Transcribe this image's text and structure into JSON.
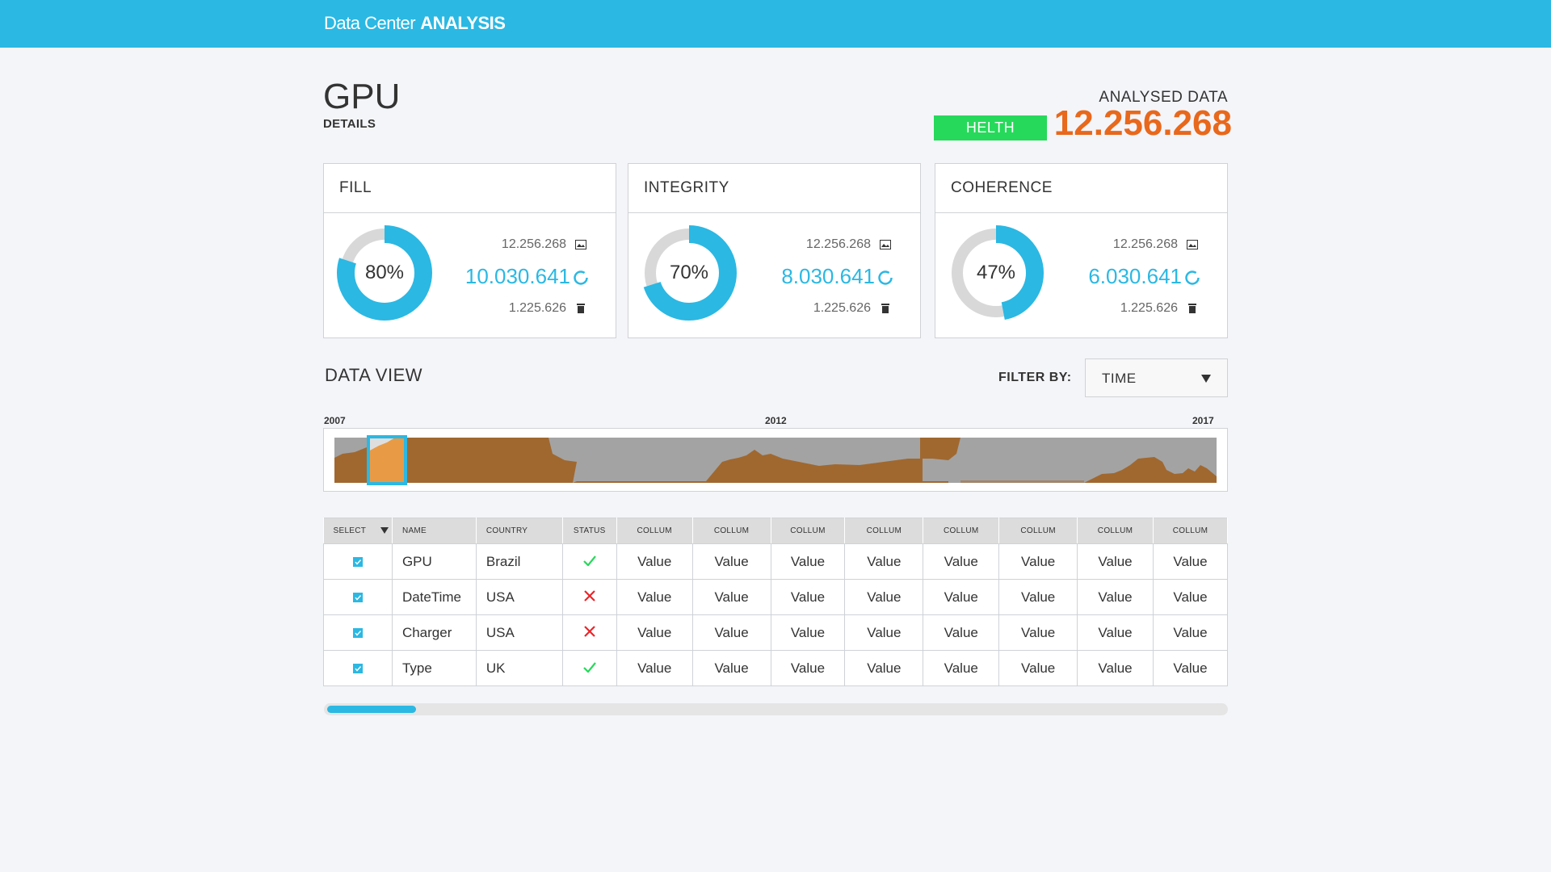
{
  "header": {
    "brand_light": "Data Center",
    "brand_bold": "ANALYSIS"
  },
  "page": {
    "title": "GPU",
    "subtitle": "DETAILS"
  },
  "summary": {
    "label": "ANALYSED DATA",
    "badge": "HELTH",
    "value": "12.256.268",
    "value_color": "#e8681c",
    "badge_color": "#26d95a"
  },
  "cards": [
    {
      "title": "FILL",
      "percent_label": "80%",
      "percent": 0.8,
      "total": "12.256.268",
      "analysed": "10.030.641",
      "deleted": "1.225.626"
    },
    {
      "title": "INTEGRITY",
      "percent_label": "70%",
      "percent": 0.7,
      "total": "12.256.268",
      "analysed": "8.030.641",
      "deleted": "1.225.626"
    },
    {
      "title": "COHERENCE",
      "percent_label": "47%",
      "percent": 0.47,
      "total": "12.256.268",
      "analysed": "6.030.641",
      "deleted": "1.225.626"
    }
  ],
  "data_view": {
    "title": "DATA VIEW",
    "filter_label": "FILTER BY:",
    "filter_value": "TIME",
    "timeline_labels": {
      "start": "2007",
      "mid": "2012",
      "end": "2017"
    }
  },
  "table": {
    "headers": [
      "SELECT",
      "NAME",
      "COUNTRY",
      "STATUS",
      "COLLUM",
      "COLLUM",
      "COLLUM",
      "COLLUM",
      "COLLUM",
      "COLLUM",
      "COLLUM",
      "COLLUM"
    ],
    "rows": [
      {
        "checked": true,
        "name": "GPU",
        "country": "Brazil",
        "status": "ok",
        "values": [
          "Value",
          "Value",
          "Value",
          "Value",
          "Value",
          "Value",
          "Value",
          "Value"
        ]
      },
      {
        "checked": true,
        "name": "DateTime",
        "country": "USA",
        "status": "error",
        "values": [
          "Value",
          "Value",
          "Value",
          "Value",
          "Value",
          "Value",
          "Value",
          "Value"
        ]
      },
      {
        "checked": true,
        "name": "Charger",
        "country": "USA",
        "status": "error",
        "values": [
          "Value",
          "Value",
          "Value",
          "Value",
          "Value",
          "Value",
          "Value",
          "Value"
        ]
      },
      {
        "checked": true,
        "name": "Type",
        "country": "UK",
        "status": "ok",
        "values": [
          "Value",
          "Value",
          "Value",
          "Value",
          "Value",
          "Value",
          "Value",
          "Value"
        ]
      }
    ]
  },
  "scrollbar": {
    "position": 0.1
  },
  "colors": {
    "accent": "#2bb8e3",
    "ok": "#26d95a",
    "error": "#e8262a",
    "timeline_fill": "#a0682f",
    "timeline_bg": "#a3a3a3",
    "timeline_highlight": "#e89a45"
  }
}
